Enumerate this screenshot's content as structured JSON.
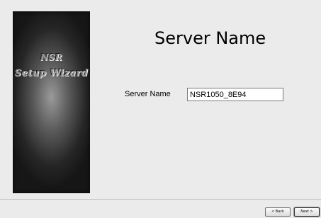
{
  "wizard": {
    "brand_line_1": "NSR",
    "brand_line_2": "Setup Wizard"
  },
  "page": {
    "title": "Server Name"
  },
  "form": {
    "server_name_label": "Server Name",
    "server_name_value": "NSR1050_8E94"
  },
  "buttons": {
    "back_label": "< Back",
    "next_label": "Next >"
  }
}
